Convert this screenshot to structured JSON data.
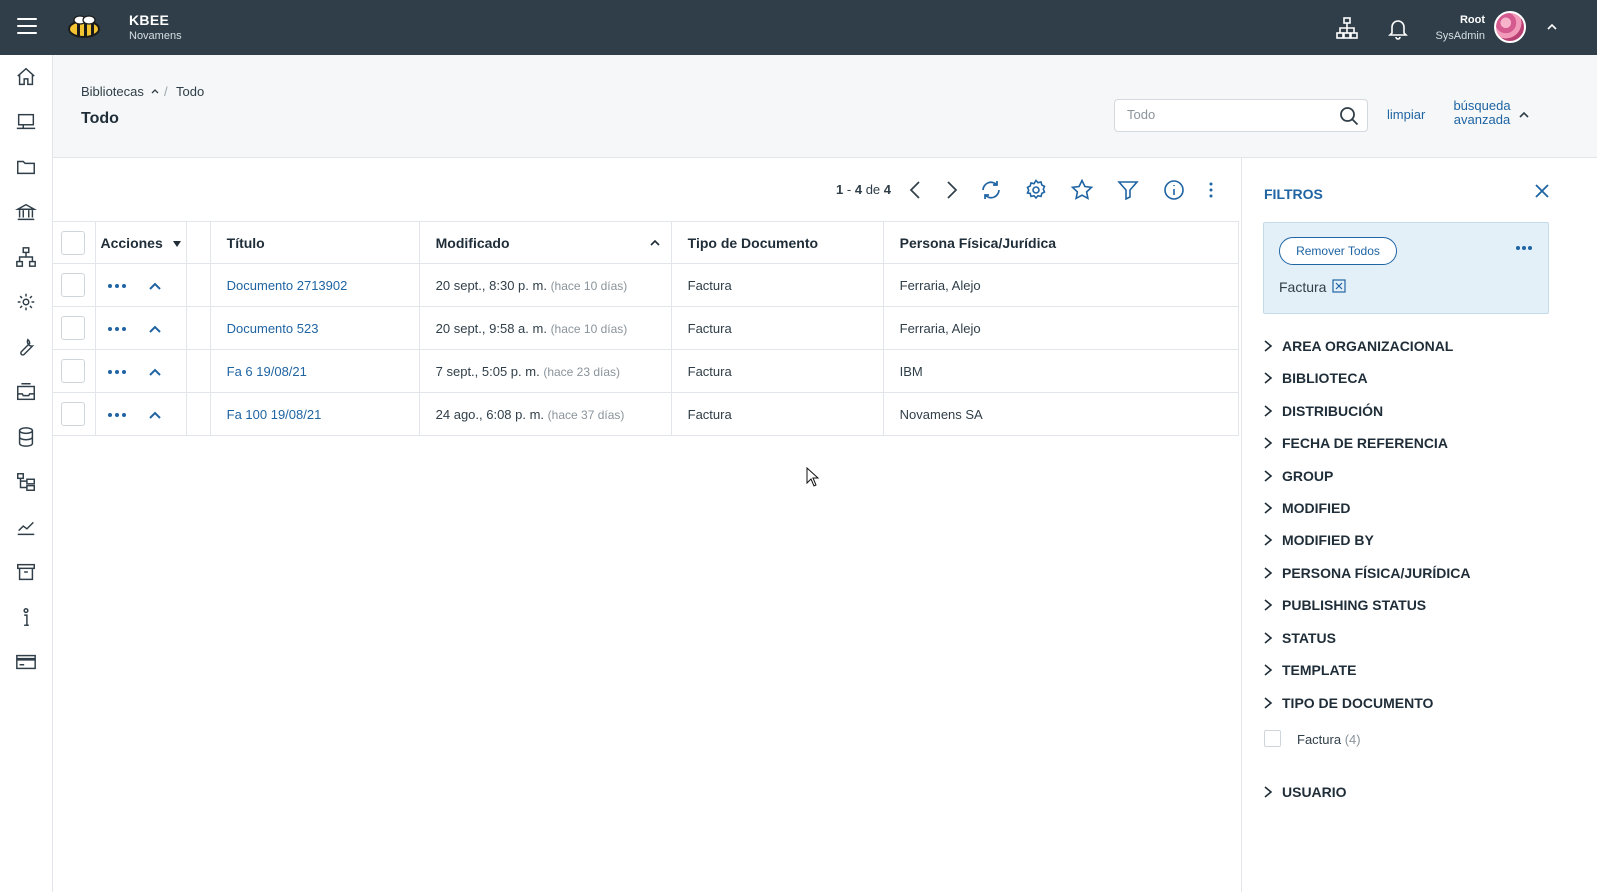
{
  "app": {
    "name": "KBEE",
    "org": "Novamens"
  },
  "user": {
    "name": "Root",
    "role": "SysAdmin"
  },
  "breadcrumb": {
    "root": "Bibliotecas",
    "separator": "/",
    "current": "Todo"
  },
  "page": {
    "title": "Todo"
  },
  "search": {
    "placeholder": "Todo",
    "clear_label": "limpiar",
    "advanced_label": "búsqueda avanzada"
  },
  "pager": {
    "from": "1",
    "to": "4",
    "of_word": "de",
    "total": "4",
    "dash": "-"
  },
  "table": {
    "headers": {
      "actions": "Acciones",
      "title": "Título",
      "modified": "Modificado",
      "doc_type": "Tipo de Documento",
      "person": "Persona Física/Jurídica"
    },
    "rows": [
      {
        "title": "Documento 2713902",
        "modified": "20 sept., 8:30 p. m.",
        "relative": "(hace 10 días)",
        "doc_type": "Factura",
        "person": "Ferraria, Alejo"
      },
      {
        "title": "Documento 523",
        "modified": "20 sept., 9:58 a. m.",
        "relative": "(hace 10 días)",
        "doc_type": "Factura",
        "person": "Ferraria, Alejo"
      },
      {
        "title": "Fa 6 19/08/21",
        "modified": "7 sept., 5:05 p. m.",
        "relative": "(hace 23 días)",
        "doc_type": "Factura",
        "person": "IBM"
      },
      {
        "title": "Fa 100 19/08/21",
        "modified": "24 ago., 6:08 p. m.",
        "relative": "(hace 37 días)",
        "doc_type": "Factura",
        "person": "Novamens SA"
      }
    ]
  },
  "filters": {
    "title": "FILTROS",
    "remove_all": "Remover Todos",
    "active_chip": "Factura",
    "facets": [
      "AREA ORGANIZACIONAL",
      "BIBLIOTECA",
      "DISTRIBUCIÓN",
      "FECHA DE REFERENCIA",
      "GROUP",
      "MODIFIED",
      "MODIFIED BY",
      "PERSONA FÍSICA/JURÍDICA",
      "PUBLISHING STATUS",
      "STATUS",
      "TEMPLATE",
      "TIPO DE DOCUMENTO",
      "USUARIO"
    ],
    "expanded_option": {
      "label": "Factura",
      "count": "(4)"
    }
  },
  "colors": {
    "topbar": "#2f3e48",
    "link": "#1f64a3",
    "active_filter_bg": "#e4f0f8"
  },
  "icons": {
    "topbar": [
      "menu-icon",
      "bee-logo",
      "org-chart-icon",
      "bell-icon",
      "avatar",
      "chevron-up-icon"
    ],
    "rail": [
      "home-icon",
      "screen-icon",
      "folder-icon",
      "bank-icon",
      "hierarchy-icon",
      "gear-icon",
      "wrench-icon",
      "inbox-icon",
      "database-icon",
      "tree-icon",
      "chart-icon",
      "archive-icon",
      "info-icon",
      "card-icon"
    ],
    "toolbar": [
      "chevron-left-icon",
      "chevron-right-icon",
      "refresh-icon",
      "gear-icon",
      "star-icon",
      "filter-icon",
      "info-icon",
      "kebab-icon"
    ]
  }
}
